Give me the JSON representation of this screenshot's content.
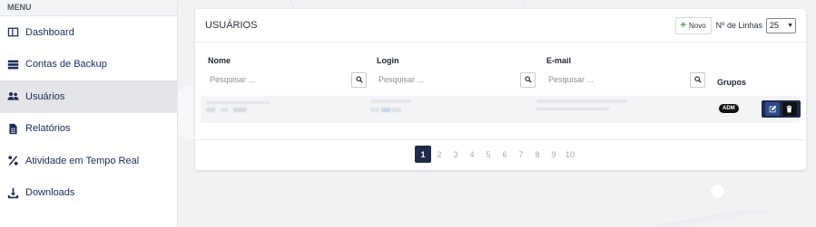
{
  "sidebar": {
    "menu_title": "MENU",
    "items": [
      {
        "label": "Dashboard",
        "icon": "columns-icon"
      },
      {
        "label": "Contas de Backup",
        "icon": "server-icon"
      },
      {
        "label": "Usuários",
        "icon": "users-icon",
        "active": true
      },
      {
        "label": "Relatórios",
        "icon": "file-icon"
      },
      {
        "label": "Atividade em Tempo Real",
        "icon": "percent-icon"
      },
      {
        "label": "Downloads",
        "icon": "download-icon"
      }
    ]
  },
  "card": {
    "title": "USUÁRIOS",
    "new_button": "Novo",
    "lines_label": "Nº de Linhas",
    "lines_value": "25"
  },
  "table": {
    "columns": [
      {
        "label": "Nome",
        "placeholder": "Pesquisar ..."
      },
      {
        "label": "Login",
        "placeholder": "Pesquisar ..."
      },
      {
        "label": "E-mail",
        "placeholder": "Pesquisar ..."
      }
    ],
    "groups_label": "Grupos",
    "rows": [
      {
        "group_badge": "ADM"
      }
    ]
  },
  "pagination": {
    "pages": [
      "1",
      "2",
      "3",
      "4",
      "5",
      "6",
      "7",
      "8",
      "9",
      "10"
    ],
    "active": "1"
  },
  "colors": {
    "accent_dark": "#1e2a4a",
    "nav_text": "#1d2a57",
    "active_nav_bg": "#e4e5e8",
    "new_plus": "#3aa64a"
  }
}
